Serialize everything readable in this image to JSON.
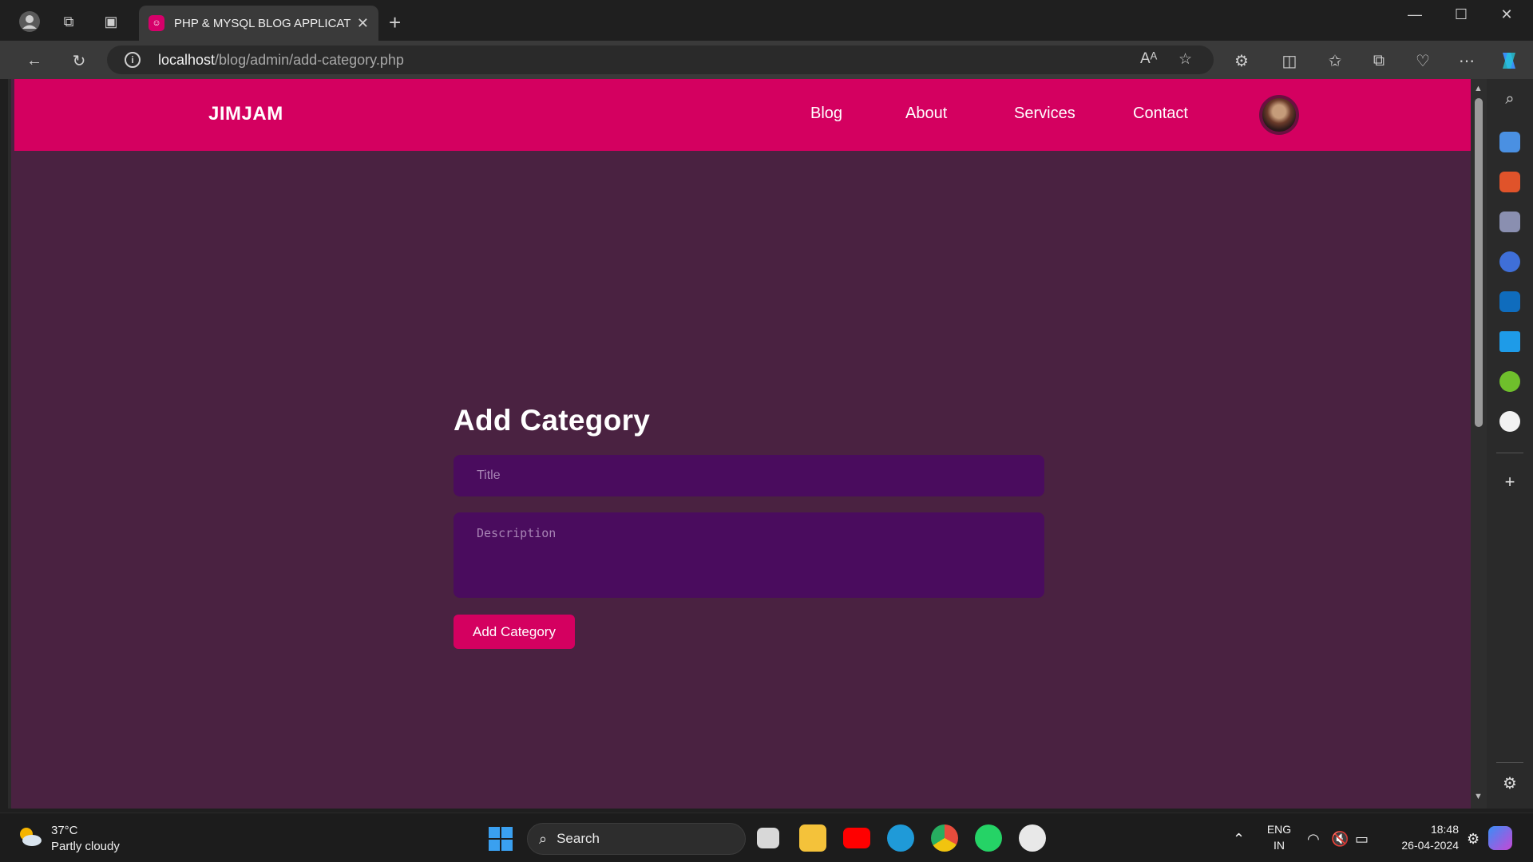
{
  "browser": {
    "tab_title": "PHP & MYSQL BLOG APPLICATION",
    "url_host": "localhost",
    "url_path": "/blog/admin/add-category.php"
  },
  "site": {
    "logo": "JIMJAM",
    "nav": [
      "Blog",
      "About",
      "Services",
      "Contact"
    ]
  },
  "form": {
    "heading": "Add Category",
    "title_placeholder": "Title",
    "description_placeholder": "Description",
    "submit_label": "Add Category"
  },
  "taskbar": {
    "temperature": "37°C",
    "weather": "Partly cloudy",
    "search_label": "Search",
    "lang_top": "ENG",
    "lang_bottom": "IN",
    "time": "18:48",
    "date": "26-04-2024"
  },
  "colors": {
    "brand": "#d40060",
    "page_bg": "#4a2241",
    "field_bg": "#4a0c5e"
  }
}
